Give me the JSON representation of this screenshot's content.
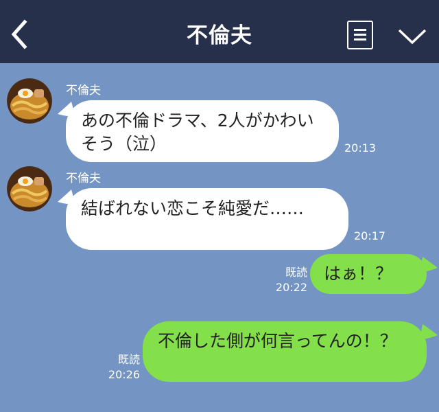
{
  "header": {
    "title": "不倫夫",
    "back_icon": "chevron-left-icon",
    "menu_icon": "menu-icon",
    "collapse_icon": "chevron-down-icon"
  },
  "colors": {
    "header_bg": "#26304b",
    "chat_bg": "#7494c3",
    "incoming_bubble": "#ffffff",
    "outgoing_bubble": "#84e04a"
  },
  "messages": [
    {
      "sender": "不倫夫",
      "text": "あの不倫ドラマ、2人がかわいそう（泣）",
      "time": "20:13"
    },
    {
      "sender": "不倫夫",
      "text": "結ばれない恋こそ純愛だ……",
      "time": "20:17"
    },
    {
      "read": "既読",
      "text": "はぁ！？",
      "time": "20:22"
    },
    {
      "read": "既読",
      "text": "不倫した側が何言ってんの！？",
      "time": "20:26"
    }
  ]
}
